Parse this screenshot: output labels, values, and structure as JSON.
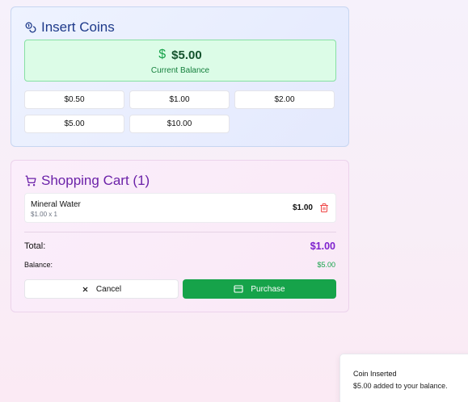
{
  "coins": {
    "title": "Insert Coins",
    "balance": {
      "currency_symbol": "$",
      "amount": "$5.00",
      "label": "Current Balance"
    },
    "options": [
      "$0.50",
      "$1.00",
      "$2.00",
      "$5.00",
      "$10.00"
    ]
  },
  "cart": {
    "title": "Shopping Cart (1)",
    "items": [
      {
        "name": "Mineral Water",
        "detail": "$1.00 x 1",
        "price": "$1.00"
      }
    ],
    "total_label": "Total:",
    "total_value": "$1.00",
    "balance_label": "Balance:",
    "balance_value": "$5.00",
    "cancel_label": "Cancel",
    "purchase_label": "Purchase"
  },
  "toast": {
    "title": "Coin Inserted",
    "message": "$5.00 added to your balance."
  },
  "colors": {
    "coins_accent": "#1e3a8a",
    "balance_bg": "#dcfce7",
    "cart_accent": "#6b21a8",
    "total": "#7e22ce",
    "primary_button": "#16a34a",
    "delete": "#ef4444"
  },
  "icons": {
    "coins": "coins-icon",
    "balance": "dollar-sign-icon",
    "cart": "shopping-cart-icon",
    "delete": "trash-icon",
    "cancel": "x-icon",
    "purchase": "credit-card-icon"
  }
}
